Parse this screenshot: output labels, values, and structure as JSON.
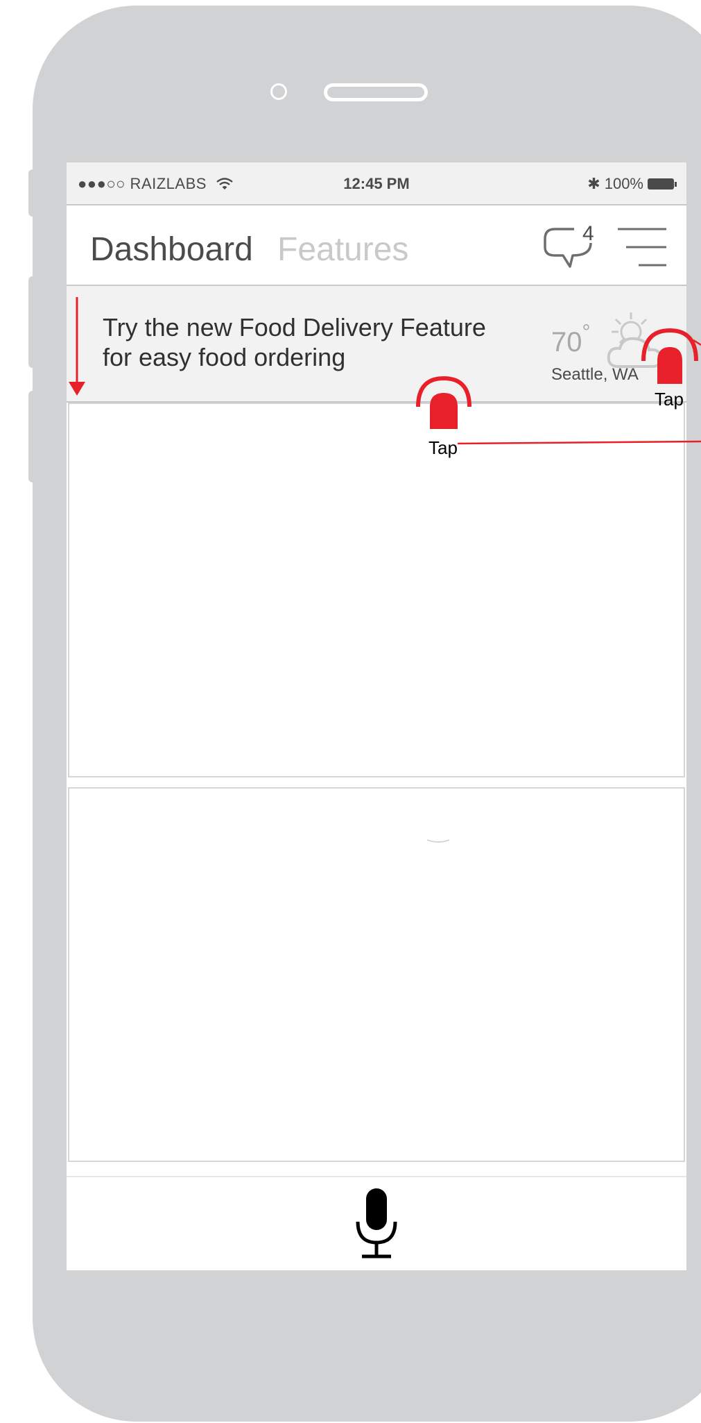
{
  "status_bar": {
    "carrier": "●●●○○ RAIZLABS",
    "time": "12:45 PM",
    "bluetooth_glyph": "✱",
    "battery": "100%"
  },
  "nav": {
    "tab_active": "Dashboard",
    "tab_inactive": "Features",
    "chat_badge": "4",
    "chat_icon": "speech-bubble-icon",
    "menu_icon": "hamburger-menu-icon"
  },
  "banner": {
    "line1": "Try the new Food Delivery Feature",
    "line2": "for easy food ordering",
    "temperature": "70",
    "degree": "°",
    "city": "Seattle, WA",
    "weather_icon": "partly-sunny-icon"
  },
  "mic": {
    "icon": "microphone-icon"
  },
  "annotations": {
    "tap_label": "Tap",
    "accent_color": "#e8202a"
  }
}
